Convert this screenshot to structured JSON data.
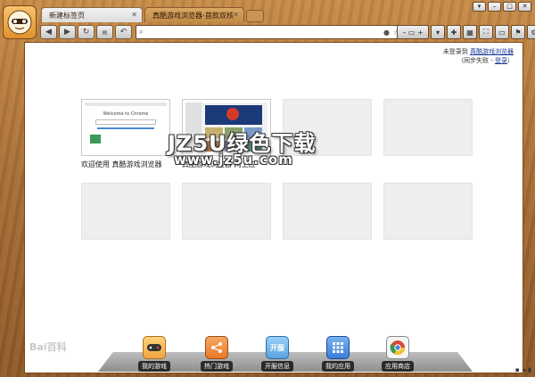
{
  "tabs": [
    {
      "label": "新建标签页",
      "active": true
    },
    {
      "label": "真酷游戏浏览器-首款双核",
      "active": false
    }
  ],
  "address": {
    "value": "",
    "placeholder": ""
  },
  "login": {
    "line1_prefix": "未登录到 ",
    "line1_link": "真酷游戏浏览器",
    "line2_prefix": "（同步失败 - ",
    "line2_link": "登录",
    "line2_suffix": "）"
  },
  "tiles": [
    {
      "label": "欢迎使用 真酷游戏浏览器",
      "filled": true,
      "shot_caption": "Welcome to Chrome"
    },
    {
      "label": "真酷游戏浏览器 网上应",
      "filled": true
    },
    {
      "label": "",
      "filled": false
    },
    {
      "label": "",
      "filled": false
    },
    {
      "label": "",
      "filled": false
    },
    {
      "label": "",
      "filled": false
    },
    {
      "label": "",
      "filled": false
    },
    {
      "label": "",
      "filled": false
    }
  ],
  "watermark": {
    "line1": "JZ5U绿色下载",
    "line2": "www.jz5u.com"
  },
  "baidu": "Bai百科",
  "dock": [
    {
      "label": "我的游戏",
      "icon": "gamepad-icon",
      "color": "#f2a640"
    },
    {
      "label": "热门游戏",
      "icon": "share-icon",
      "color": "#e87a2a"
    },
    {
      "label": "开服信息",
      "icon": "calendar-icon",
      "color": "#5aa3e0",
      "glyph": "开服"
    },
    {
      "label": "我的应用",
      "icon": "grid-icon",
      "color": "#3a7fd8"
    },
    {
      "label": "应用商店",
      "icon": "chrome-icon",
      "color": "#d94a3a"
    }
  ],
  "colors": {
    "frame": "#a56a33",
    "accent": "#1a3a9a"
  }
}
